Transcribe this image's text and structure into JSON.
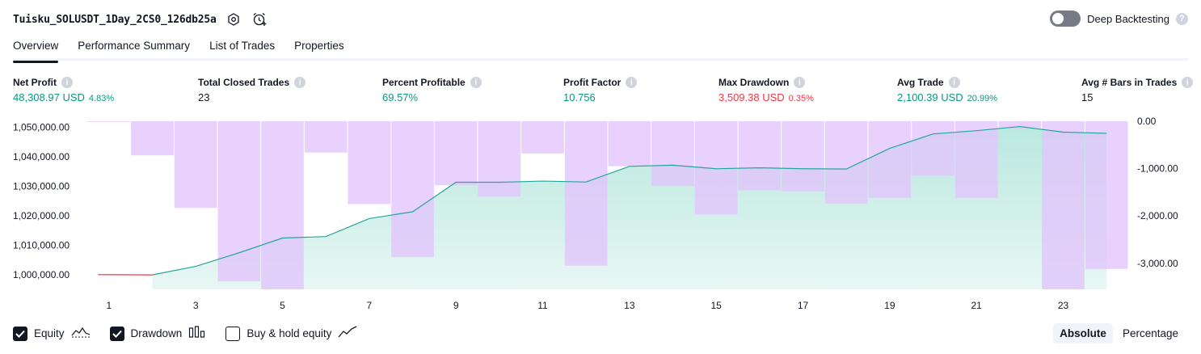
{
  "header": {
    "title": "Tuisku_SOLUSDT_1Day_2CS0_126db25a",
    "settings_icon": "hexagon-gear-icon",
    "alert_icon": "alarm-clock-plus-icon",
    "deep_backtesting_label": "Deep Backtesting",
    "deep_backtesting_on": false,
    "help_glyph": "?"
  },
  "tabs": [
    {
      "label": "Overview",
      "active": true
    },
    {
      "label": "Performance Summary",
      "active": false
    },
    {
      "label": "List of Trades",
      "active": false
    },
    {
      "label": "Properties",
      "active": false
    }
  ],
  "metrics": [
    {
      "label": "Net Profit",
      "value": "48,308.97 USD",
      "pct": "4.83%",
      "color": "green"
    },
    {
      "label": "Total Closed Trades",
      "value": "23",
      "pct": "",
      "color": "dark"
    },
    {
      "label": "Percent Profitable",
      "value": "69.57%",
      "pct": "",
      "color": "green"
    },
    {
      "label": "Profit Factor",
      "value": "10.756",
      "pct": "",
      "color": "green"
    },
    {
      "label": "Max Drawdown",
      "value": "3,509.38 USD",
      "pct": "0.35%",
      "color": "red"
    },
    {
      "label": "Avg Trade",
      "value": "2,100.39 USD",
      "pct": "20.99%",
      "color": "green"
    },
    {
      "label": "Avg # Bars in Trades",
      "value": "15",
      "pct": "",
      "color": "dark"
    }
  ],
  "info_glyph": "i",
  "chart_data": {
    "type": "area",
    "x": [
      1,
      2,
      3,
      4,
      5,
      6,
      7,
      8,
      9,
      10,
      11,
      12,
      13,
      14,
      15,
      16,
      17,
      18,
      19,
      20,
      21,
      22,
      23,
      24
    ],
    "x_tick_labels": [
      "1",
      "3",
      "5",
      "7",
      "9",
      "11",
      "13",
      "15",
      "17",
      "19",
      "21",
      "23"
    ],
    "y_left_ticks": [
      "1,050,000.00",
      "1,040,000.00",
      "1,030,000.00",
      "1,020,000.00",
      "1,010,000.00",
      "1,000,000.00"
    ],
    "y_right_ticks": [
      "0.00",
      "-1,000.00",
      "-2,000.00",
      "-3,000.00"
    ],
    "ylim_left": [
      995000,
      1052000
    ],
    "ylim_right": [
      -3550,
      0
    ],
    "series": [
      {
        "name": "Equity",
        "axis": "left",
        "values": [
          1000000,
          999900,
          1002800,
          1007400,
          1012400,
          1012900,
          1019000,
          1021300,
          1031300,
          1031300,
          1031700,
          1031400,
          1036700,
          1037100,
          1035900,
          1036200,
          1035900,
          1035800,
          1042800,
          1047700,
          1048800,
          1050200,
          1048300,
          1047900
        ]
      },
      {
        "name": "Drawdown",
        "axis": "right",
        "values": [
          0,
          -720,
          -1830,
          -3380,
          -3550,
          -660,
          -1750,
          -2870,
          -1350,
          -1590,
          -680,
          -3050,
          -950,
          -1370,
          -1970,
          -1460,
          -1480,
          -1740,
          -1620,
          -1150,
          -1620,
          -150,
          -3550,
          -3120
        ]
      }
    ],
    "colors": {
      "equity_line": "#26a69a",
      "equity_negative_line": "#f23645",
      "equity_fill": "#c9ede6",
      "drawdown_bar": "#e2c4fc",
      "overlap_bar": "#b0b4e6"
    },
    "grid": false
  },
  "legend": [
    {
      "label": "Equity",
      "checked": true,
      "icon": "equity-line-icon"
    },
    {
      "label": "Drawdown",
      "checked": true,
      "icon": "drawdown-bars-icon"
    },
    {
      "label": "Buy & hold equity",
      "checked": false,
      "icon": "buy-hold-line-icon"
    }
  ],
  "mode": [
    {
      "label": "Absolute",
      "active": true
    },
    {
      "label": "Percentage",
      "active": false
    }
  ]
}
